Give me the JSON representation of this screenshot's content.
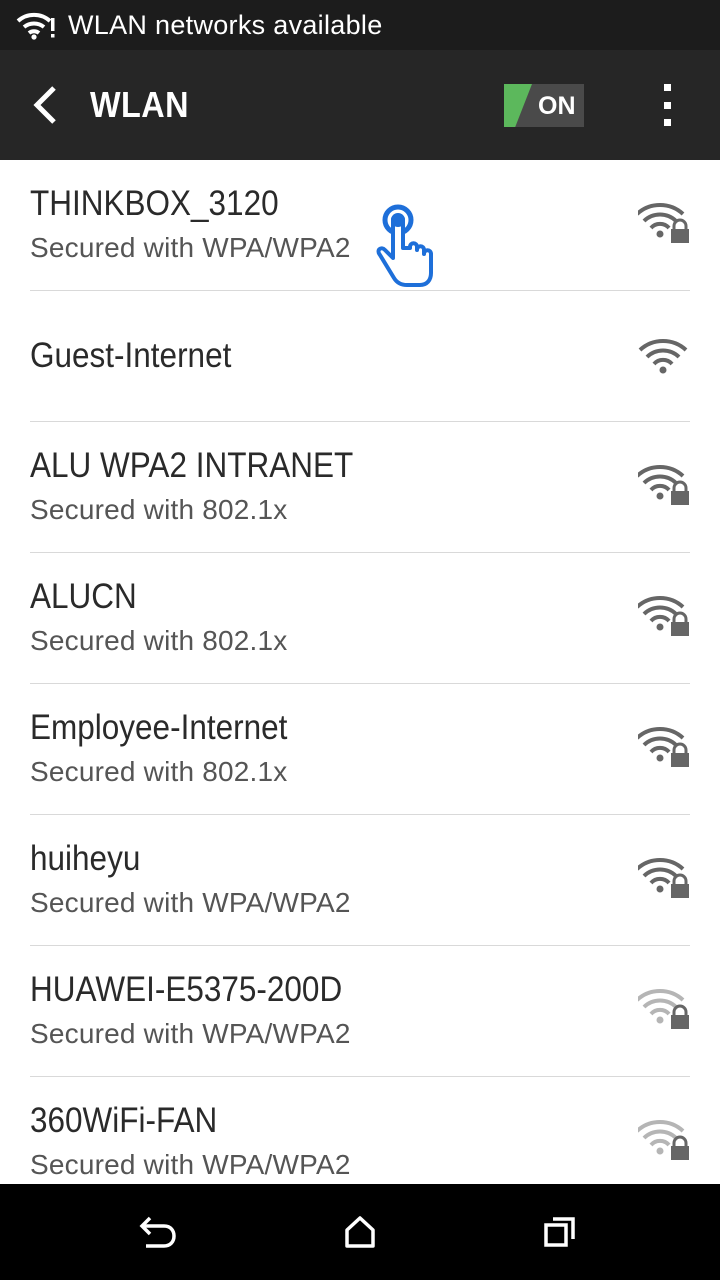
{
  "status_bar": {
    "notification_text": "WLAN networks available",
    "icon": "wifi-alert-icon"
  },
  "action_bar": {
    "title": "WLAN",
    "back_icon": "chevron-left-icon",
    "toggle_label": "ON",
    "toggle_on": true,
    "menu_icon": "overflow-menu-icon"
  },
  "networks": [
    {
      "name": "THINKBOX_3120",
      "security": "Secured with WPA/WPA2",
      "secured": true,
      "signal": "strong"
    },
    {
      "name": "Guest-Internet",
      "security": "",
      "secured": false,
      "signal": "strong"
    },
    {
      "name": "ALU WPA2 INTRANET",
      "security": "Secured with 802.1x",
      "secured": true,
      "signal": "strong"
    },
    {
      "name": "ALUCN",
      "security": "Secured with 802.1x",
      "secured": true,
      "signal": "strong"
    },
    {
      "name": "Employee-Internet",
      "security": "Secured with 802.1x",
      "secured": true,
      "signal": "strong"
    },
    {
      "name": "huiheyu",
      "security": "Secured with WPA/WPA2",
      "secured": true,
      "signal": "strong"
    },
    {
      "name": "HUAWEI-E5375-200D",
      "security": "Secured with WPA/WPA2",
      "secured": true,
      "signal": "weak"
    },
    {
      "name": "360WiFi-FAN",
      "security": "Secured with WPA/WPA2",
      "secured": true,
      "signal": "weak"
    }
  ],
  "nav_bar": {
    "back_icon": "nav-back-icon",
    "home_icon": "nav-home-icon",
    "recents_icon": "nav-recents-icon"
  },
  "colors": {
    "status_bar": "#1c1c1c",
    "action_bar": "#262626",
    "toggle_accent": "#5cb85c",
    "signal_strong": "#666666",
    "signal_weak": "#b5b5b5",
    "touch_indicator": "#1e6fd9"
  }
}
